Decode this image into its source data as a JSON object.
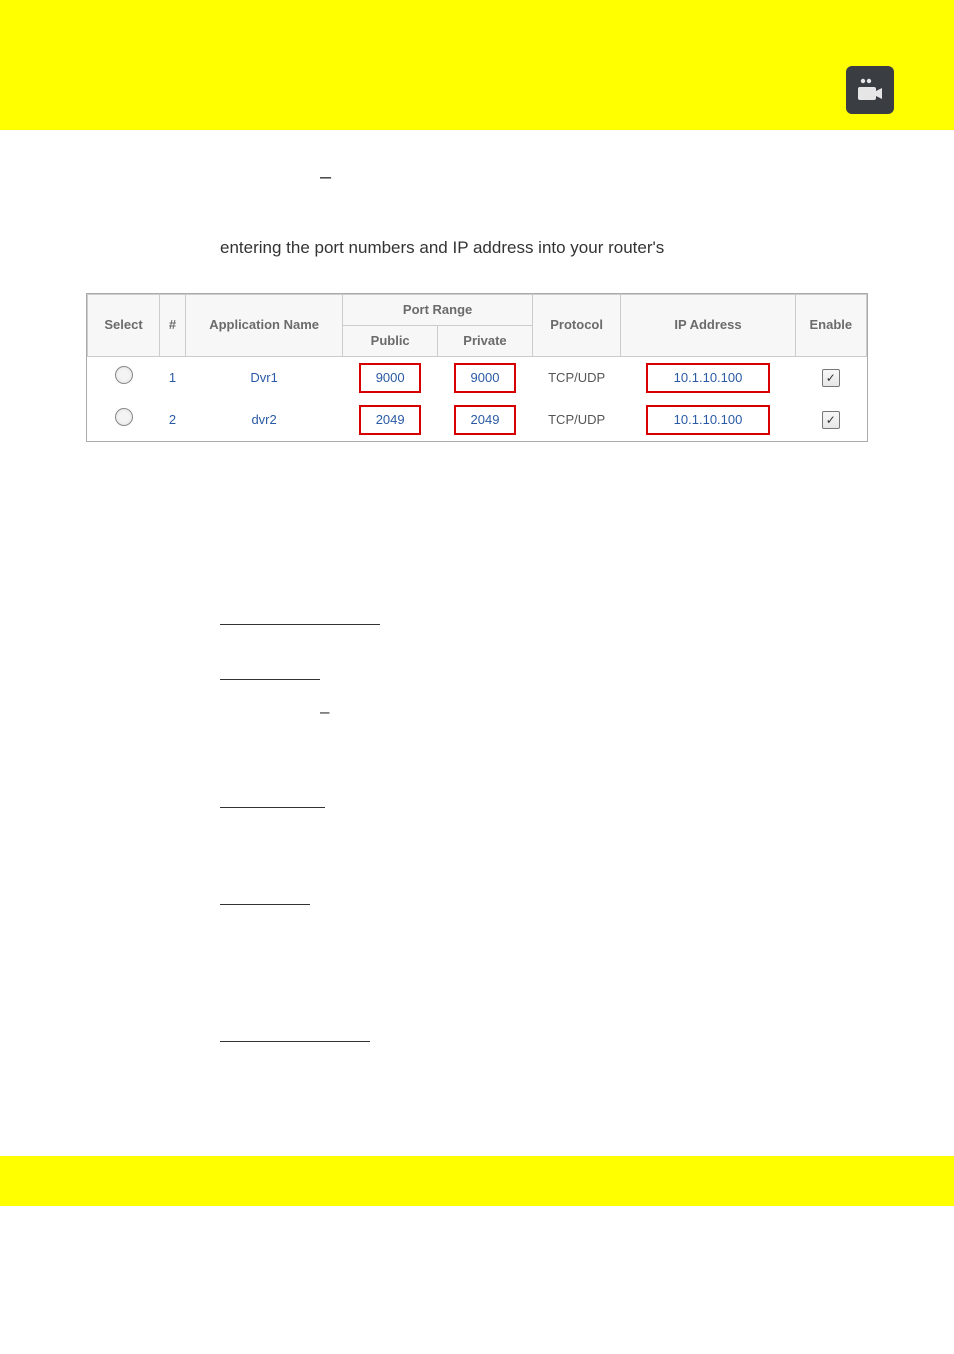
{
  "dash": "–",
  "paragraph": "entering the port numbers and IP address into your router's",
  "table": {
    "headers": {
      "select": "Select",
      "num": "#",
      "app": "Application Name",
      "portrange": "Port Range",
      "public": "Public",
      "private": "Private",
      "protocol": "Protocol",
      "ip": "IP Address",
      "enable": "Enable"
    },
    "rows": [
      {
        "num": "1",
        "app": "Dvr1",
        "pub": "9000",
        "priv": "9000",
        "proto": "TCP/UDP",
        "ip": "10.1.10.100",
        "checked": true,
        "highlight": true
      },
      {
        "num": "2",
        "app": "dvr2",
        "pub": "2049",
        "priv": "2049",
        "proto": "TCP/UDP",
        "ip": "10.1.10.100",
        "checked": true,
        "highlight": false
      }
    ]
  },
  "links": {
    "l1": "",
    "l2": "",
    "sep": "–",
    "l3": "",
    "l4": "",
    "l5": ""
  }
}
